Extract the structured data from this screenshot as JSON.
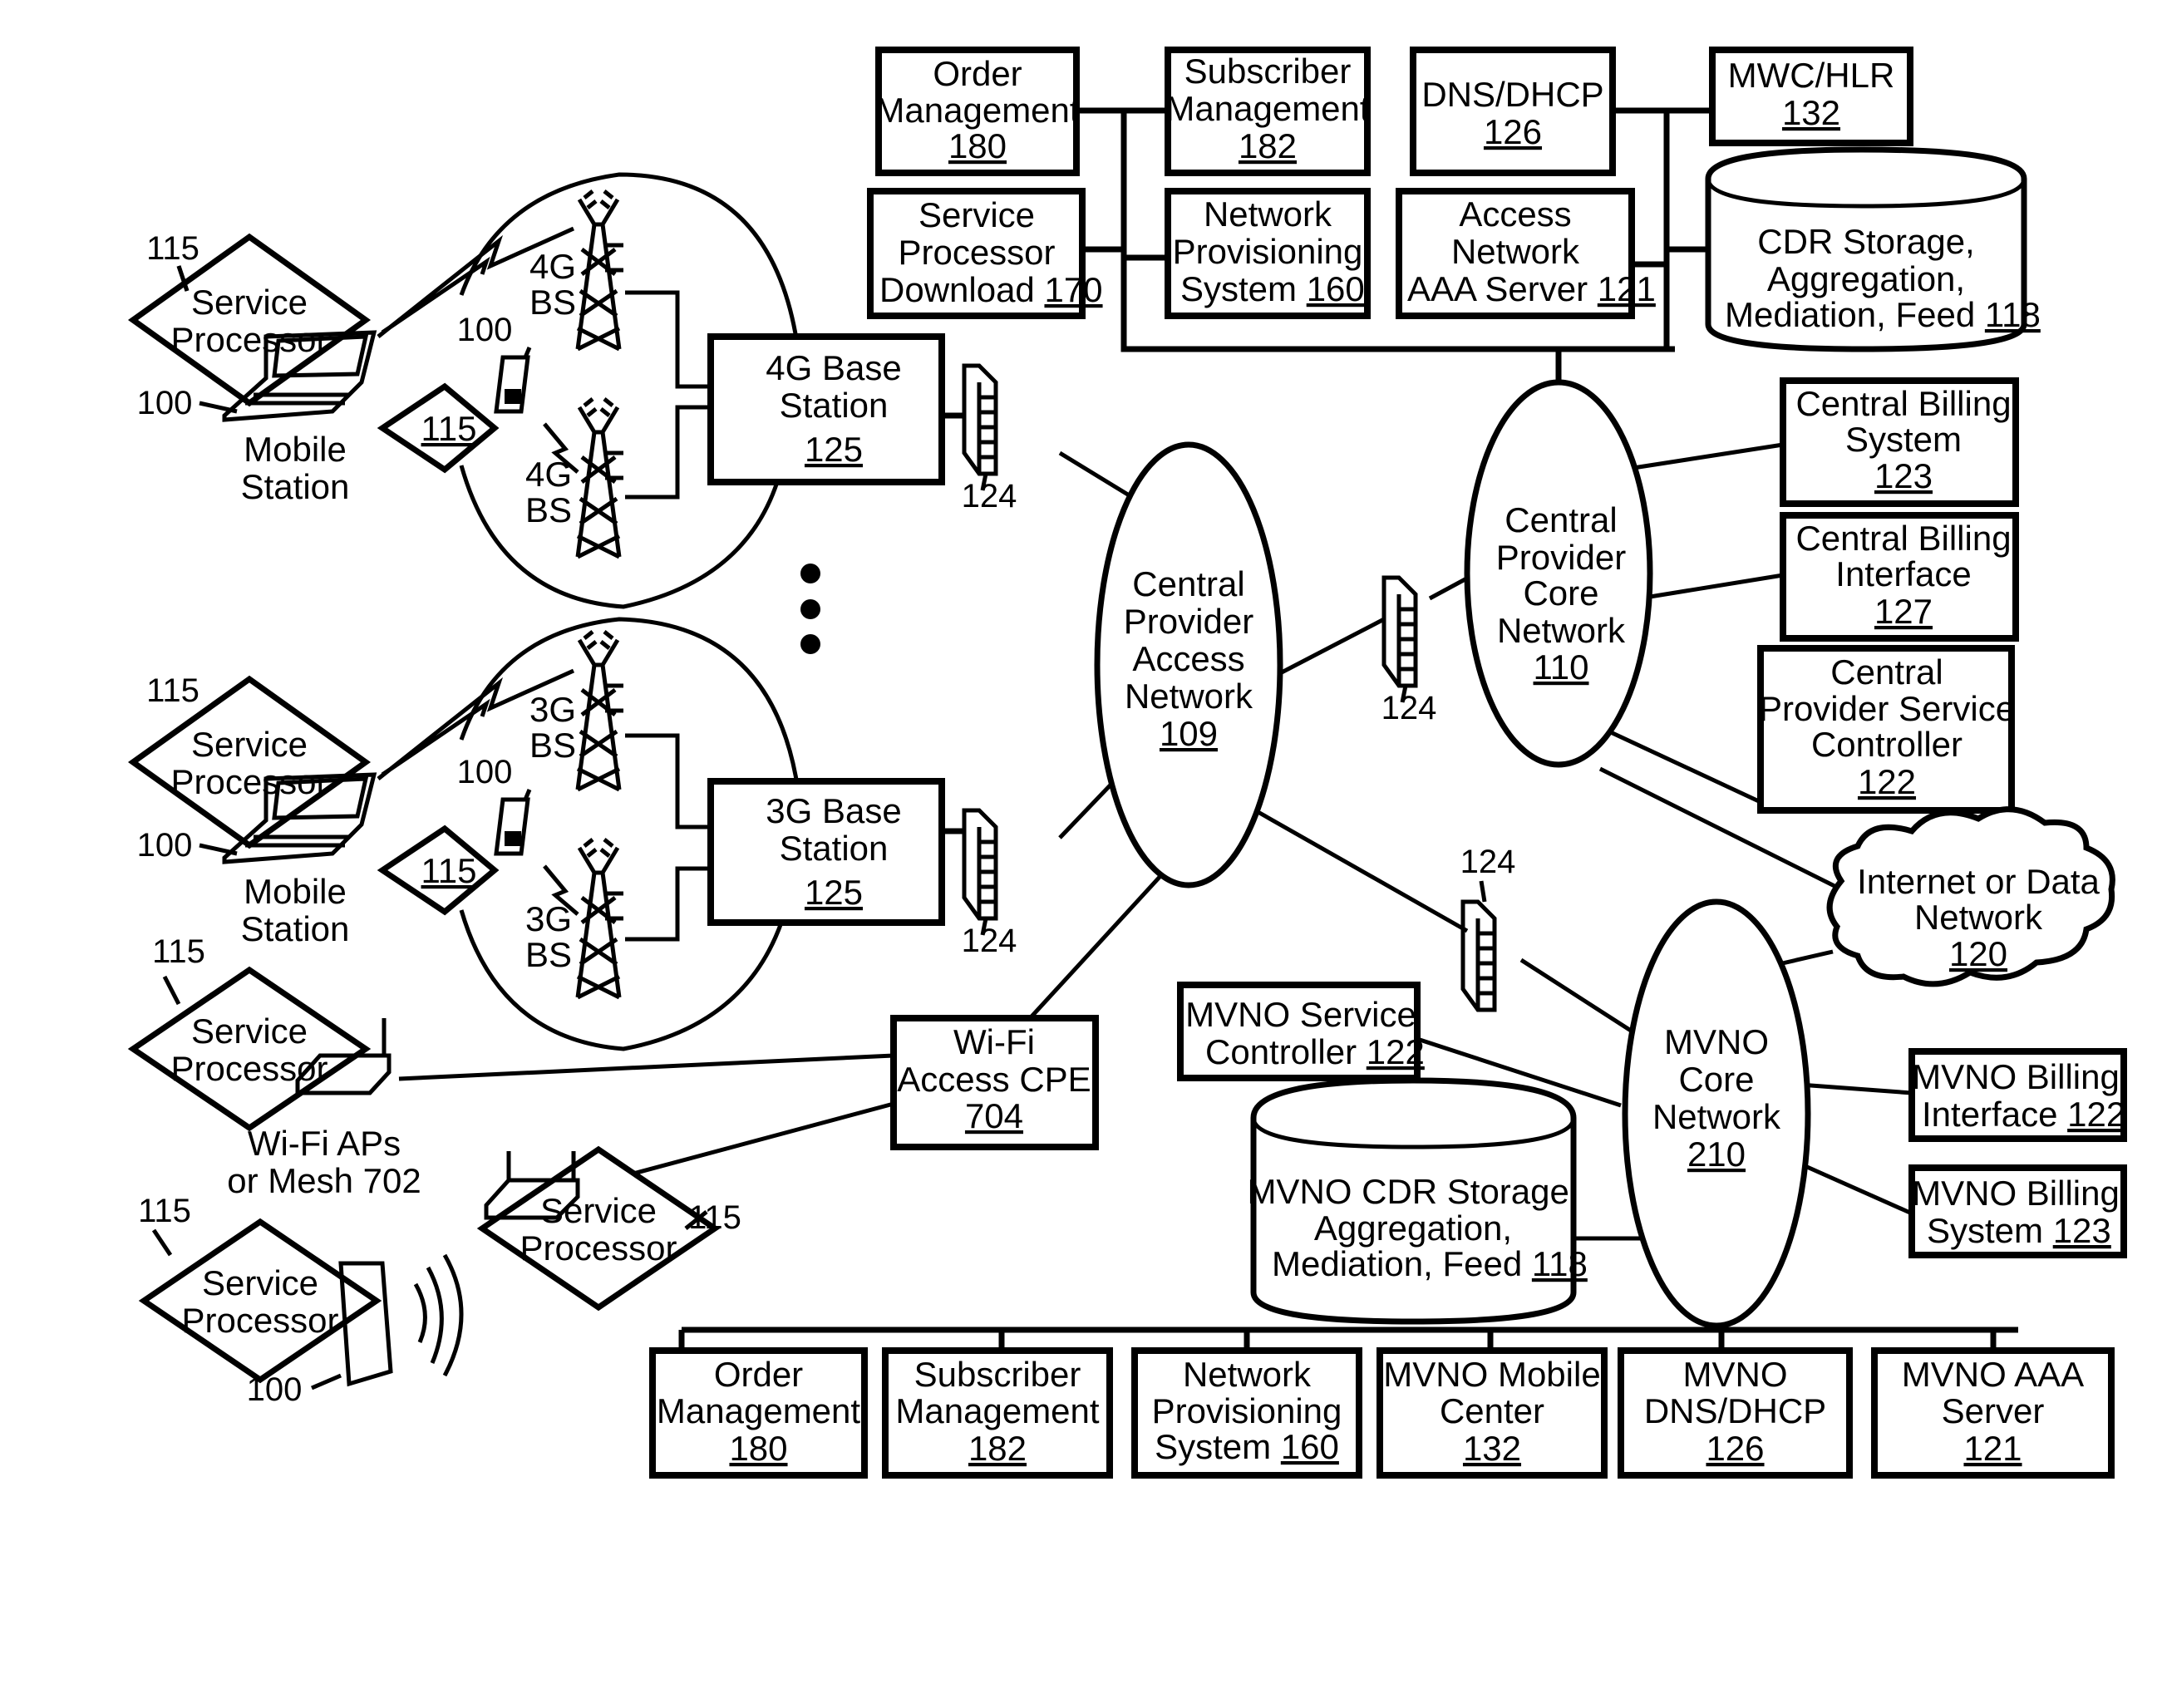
{
  "central_backend": {
    "order_management": {
      "lines": [
        "Order",
        "Management"
      ],
      "ref": "180"
    },
    "subscriber_management": {
      "lines": [
        "Subscriber",
        "Management"
      ],
      "ref": "182"
    },
    "service_processor_download": {
      "lines": [
        "Service",
        "Processor",
        "Download"
      ],
      "ref": "170"
    },
    "network_provisioning": {
      "lines": [
        "Network",
        "Provisioning",
        "System"
      ],
      "ref": "160"
    },
    "dns_dhcp": {
      "lines": [
        "DNS/DHCP"
      ],
      "ref": "126"
    },
    "mwc_hlr": {
      "lines": [
        "MWC/HLR"
      ],
      "ref": "132"
    },
    "access_network_aaa": {
      "lines": [
        "Access",
        "Network",
        "AAA Server"
      ],
      "ref": "121"
    },
    "cdr_storage": {
      "lines": [
        "CDR Storage,",
        "Aggregation,",
        "Mediation, Feed"
      ],
      "ref": "118"
    }
  },
  "central_core": {
    "lines": [
      "Central",
      "Provider",
      "Core",
      "Network"
    ],
    "ref": "110"
  },
  "central_access": {
    "lines": [
      "Central",
      "Provider",
      "Access",
      "Network"
    ],
    "ref": "109"
  },
  "central_billing_system": {
    "lines": [
      "Central Billing",
      "System"
    ],
    "ref": "123"
  },
  "central_billing_interface": {
    "lines": [
      "Central Billing",
      "Interface"
    ],
    "ref": "127"
  },
  "central_service_controller": {
    "lines": [
      "Central",
      "Provider Service",
      "Controller"
    ],
    "ref": "122"
  },
  "internet": {
    "lines": [
      "Internet or Data",
      "Network"
    ],
    "ref": "120"
  },
  "base_station_4g": {
    "lines": [
      "4G Base",
      "Station"
    ],
    "ref": "125",
    "tower_labels": [
      [
        "4G",
        "BS"
      ],
      [
        "4G",
        "BS"
      ]
    ]
  },
  "base_station_3g": {
    "lines": [
      "3G Base",
      "Station"
    ],
    "ref": "125",
    "tower_labels": [
      [
        "3G",
        "BS"
      ],
      [
        "3G",
        "BS"
      ]
    ]
  },
  "firewall_label": "124",
  "wifi_cpe": {
    "lines": [
      "Wi-Fi",
      "Access CPE"
    ],
    "ref": "704"
  },
  "wifi_aps": {
    "lines": [
      "Wi-Fi APs",
      "or Mesh 702"
    ]
  },
  "service_processor": {
    "lines": [
      "Service",
      "Processor"
    ],
    "ref": "115"
  },
  "mobile_station": {
    "lines": [
      "Mobile",
      "Station"
    ],
    "ref": "100"
  },
  "mvno_core": {
    "lines": [
      "MVNO",
      "Core",
      "Network"
    ],
    "ref": "210"
  },
  "mvno_service_controller": {
    "lines": [
      "MVNO Service",
      "Controller"
    ],
    "ref": "122"
  },
  "mvno_cdr": {
    "lines": [
      "MVNO CDR Storage,",
      "Aggregation,",
      "Mediation, Feed"
    ],
    "ref": "118"
  },
  "mvno_billing_interface": {
    "lines": [
      "MVNO Billing",
      "Interface"
    ],
    "ref": "122"
  },
  "mvno_billing_system": {
    "lines": [
      "MVNO Billing",
      "System"
    ],
    "ref": "123"
  },
  "mvno_backend": [
    {
      "lines": [
        "Order",
        "Management"
      ],
      "ref": "180"
    },
    {
      "lines": [
        "Subscriber",
        "Management"
      ],
      "ref": "182"
    },
    {
      "lines": [
        "Network",
        "Provisioning",
        "System"
      ],
      "ref": "160"
    },
    {
      "lines": [
        "MVNO Mobile",
        "Center"
      ],
      "ref": "132"
    },
    {
      "lines": [
        "MVNO",
        "DNS/DHCP"
      ],
      "ref": "126"
    },
    {
      "lines": [
        "MVNO AAA",
        "Server"
      ],
      "ref": "121"
    }
  ],
  "icons": {
    "firewall": "firewall-icon",
    "tower": "cell-tower-icon",
    "laptop": "laptop-icon",
    "phone": "mobile-phone-icon",
    "router": "wifi-router-icon",
    "tablet": "tablet-icon",
    "cloud": "cloud-icon",
    "database": "database-icon"
  }
}
